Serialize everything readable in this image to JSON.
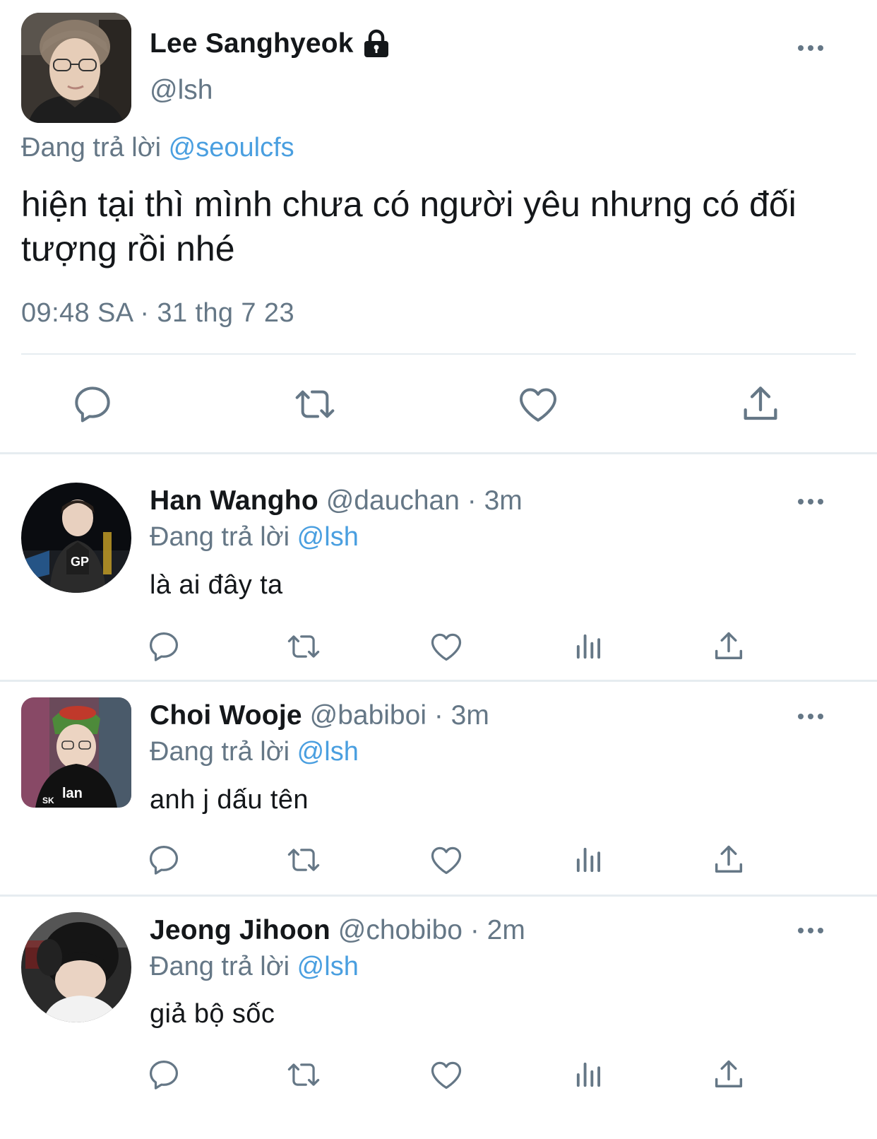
{
  "main_tweet": {
    "name": "Lee Sanghyeok",
    "handle": "@lsh",
    "protected_icon": "lock-icon",
    "replying_prefix": "Đang trả lời",
    "replying_mention": "@seoulcfs",
    "text": "hiện tại thì mình chưa có người yêu nhưng có đối tượng rồi nhé",
    "timestamp": "09:48 SA · 31 thg 7 23",
    "actions": [
      "reply-icon",
      "retweet-icon",
      "like-icon",
      "share-icon"
    ]
  },
  "replies": [
    {
      "name": "Han Wangho",
      "handle": "@dauchan",
      "time": "· 3m",
      "replying_prefix": "Đang trả lời",
      "replying_mention": "@lsh",
      "text": "là ai đây ta"
    },
    {
      "name": "Choi Wooje",
      "handle": "@babiboi",
      "time": "· 3m",
      "replying_prefix": "Đang trả lời",
      "replying_mention": "@lsh",
      "text": "anh j dấu tên"
    },
    {
      "name": "Jeong Jihoon",
      "handle": "@chobibo",
      "time": "· 2m",
      "replying_prefix": "Đang trả lời",
      "replying_mention": "@lsh",
      "text": "giả bộ sốc"
    }
  ],
  "reply_actions": [
    "reply-icon",
    "retweet-icon",
    "like-icon",
    "analytics-icon",
    "share-icon"
  ],
  "colors": {
    "text": "#14171a",
    "secondary": "#657786",
    "mention": "#4a9fe0",
    "divider": "#e6ecf0",
    "icon": "#657786"
  }
}
